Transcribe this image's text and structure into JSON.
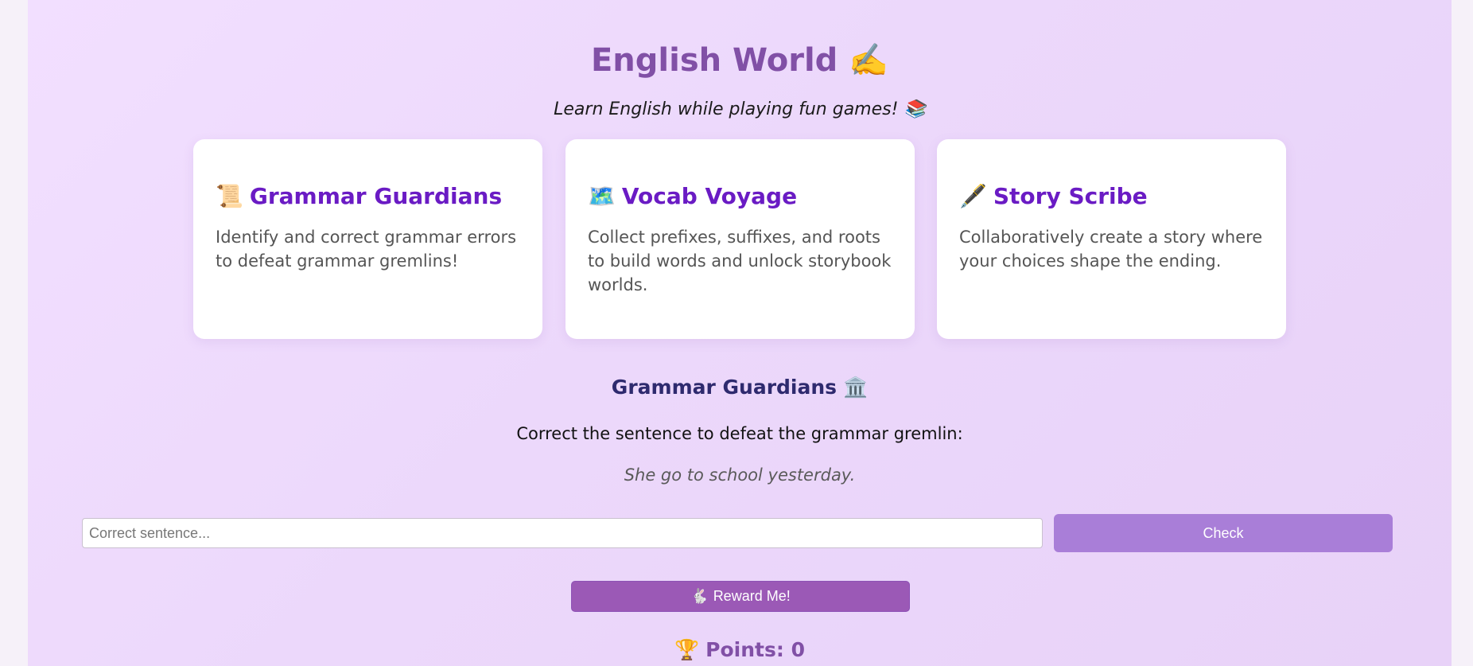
{
  "header": {
    "title": "English World",
    "title_icon": "✍️",
    "subtitle": "Learn English while playing fun games!",
    "subtitle_icon": "📚"
  },
  "cards": [
    {
      "icon": "📜",
      "icon_name": "scroll-icon",
      "title": "Grammar Guardians",
      "description": "Identify and correct grammar errors to defeat grammar gremlins!"
    },
    {
      "icon": "🗺️",
      "icon_name": "map-icon",
      "title": "Vocab Voyage",
      "description": "Collect prefixes, suffixes, and roots to build words and unlock storybook worlds."
    },
    {
      "icon": "🖋️",
      "icon_name": "fountain-pen-icon",
      "title": "Story Scribe",
      "description": "Collaboratively create a story where your choices shape the ending."
    }
  ],
  "game": {
    "title": "Grammar Guardians",
    "title_icon": "🏛️",
    "instruction": "Correct the sentence to defeat the grammar gremlin:",
    "sentence": "She go to school yesterday.",
    "input_placeholder": "Correct sentence...",
    "input_value": "",
    "check_label": "Check",
    "reward_icon": "🐇",
    "reward_label": "Reward Me!",
    "points_icon": "🏆",
    "points_text": "Points: 0"
  },
  "colors": {
    "accent": "#8150a6",
    "card_title": "#6a1bc4",
    "check_button": "#a97ed8",
    "reward_button": "#9b59b6"
  }
}
